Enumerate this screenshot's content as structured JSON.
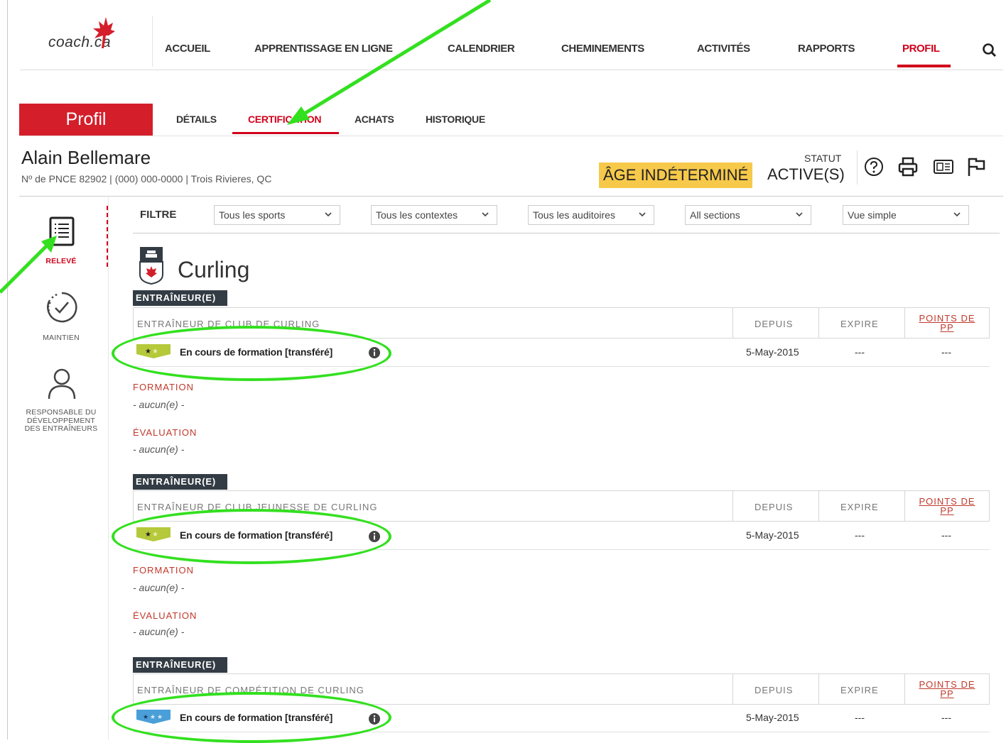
{
  "nav": {
    "logo": "coach.ca",
    "items": [
      "ACCUEIL",
      "APPRENTISSAGE EN LIGNE",
      "CALENDRIER",
      "CHEMINEMENTS",
      "ACTIVITÉS",
      "RAPPORTS",
      "PROFIL"
    ],
    "active": "PROFIL"
  },
  "profile": {
    "section_title": "Profil",
    "tabs": [
      "DÉTAILS",
      "CERTIFICATION",
      "ACHATS",
      "HISTORIQUE"
    ],
    "active_tab": "CERTIFICATION"
  },
  "person": {
    "name": "Alain Bellemare",
    "info": "Nº de PNCE 82902  |  (000) 000-0000  |  Trois Rivieres, QC",
    "age_badge": "ÂGE INDÉTERMINÉ",
    "statut_label": "STATUT",
    "statut_value": "ACTIVE(S)"
  },
  "sidenav": {
    "releve": "RELEVÉ",
    "maintien": "MAINTIEN",
    "responsable": "RESPONSABLE DU DÉVELOPPEMENT DES ENTRAÎNEURS"
  },
  "filter": {
    "label": "FILTRE",
    "selects": [
      "Tous les sports",
      "Tous les contextes",
      "Tous les auditoires",
      "All sections",
      "Vue simple"
    ]
  },
  "sport": {
    "name": "Curling"
  },
  "columns": {
    "depuis": "DEPUIS",
    "expire": "EXPIRE",
    "points": "POINTS DE PP"
  },
  "certs": [
    {
      "role": "ENTRAÎNEUR(E)",
      "title": "ENTRAÎNEUR DE CLUB DE CURLING",
      "status": "En cours de formation [transféré]",
      "depuis": "5-May-2015",
      "expire": "---",
      "points": "---",
      "formation_label": "FORMATION",
      "formation_value": "- aucun(e) -",
      "evaluation_label": "ÉVALUATION",
      "evaluation_value": "- aucun(e) -"
    },
    {
      "role": "ENTRAÎNEUR(E)",
      "title": "ENTRAÎNEUR DE CLUB JEUNESSE DE CURLING",
      "status": "En cours de formation [transféré]",
      "depuis": "5-May-2015",
      "expire": "---",
      "points": "---",
      "formation_label": "FORMATION",
      "formation_value": "- aucun(e) -",
      "evaluation_label": "ÉVALUATION",
      "evaluation_value": "- aucun(e) -"
    },
    {
      "role": "ENTRAÎNEUR(E)",
      "title": "ENTRAÎNEUR DE COMPÉTITION DE CURLING",
      "status": "En cours de formation [transféré]",
      "depuis": "5-May-2015",
      "expire": "---",
      "points": "---"
    }
  ],
  "colors": {
    "brand_red": "#d41f2b",
    "active_red": "#d0021b",
    "badge_yellow": "#f7c94a",
    "annotation_green": "#33e01f",
    "level_green": "#b5c93a",
    "level_blue": "#4a9fd8"
  }
}
